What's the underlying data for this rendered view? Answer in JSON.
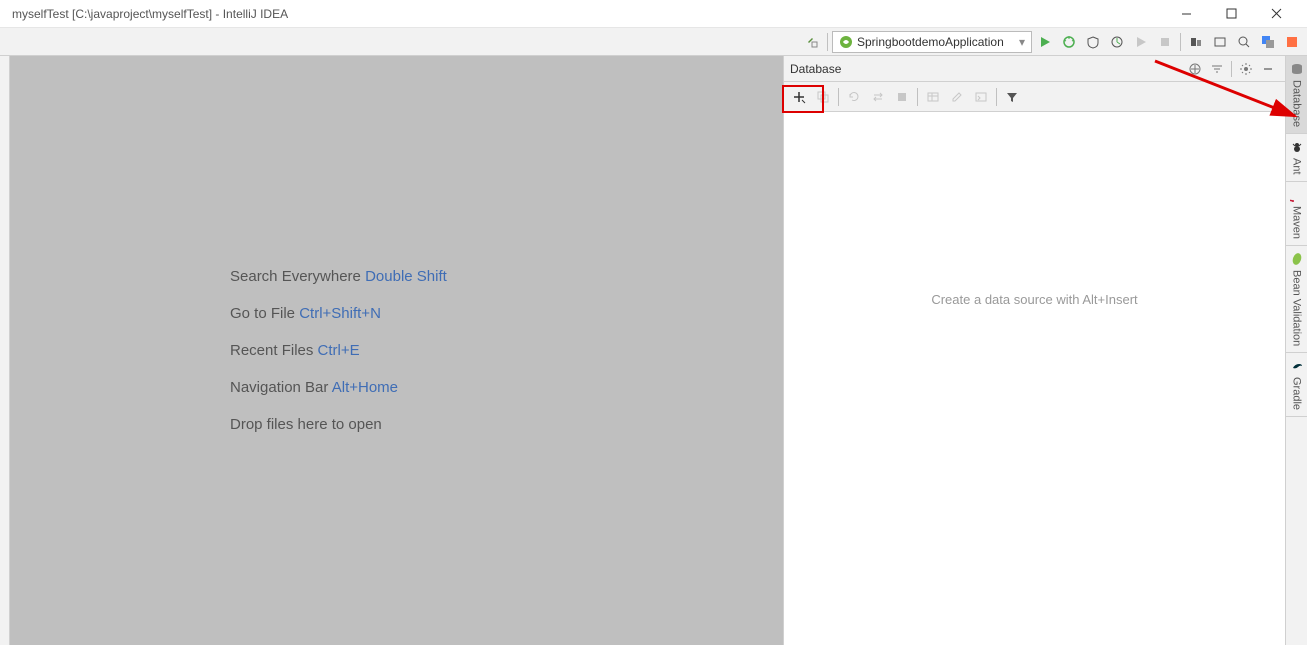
{
  "window": {
    "title": "myselfTest [C:\\javaproject\\myselfTest] - IntelliJ IDEA"
  },
  "toolbar": {
    "run_config": "SpringbootdemoApplication"
  },
  "editor_hints": [
    {
      "label": "Search Everywhere",
      "shortcut": "Double Shift"
    },
    {
      "label": "Go to File",
      "shortcut": "Ctrl+Shift+N"
    },
    {
      "label": "Recent Files",
      "shortcut": "Ctrl+E"
    },
    {
      "label": "Navigation Bar",
      "shortcut": "Alt+Home"
    },
    {
      "label": "Drop files here to open",
      "shortcut": ""
    }
  ],
  "database_panel": {
    "title": "Database",
    "placeholder": "Create a data source with Alt+Insert"
  },
  "right_tabs": [
    {
      "label": "Database",
      "icon": "database"
    },
    {
      "label": "Ant",
      "icon": "ant"
    },
    {
      "label": "Maven",
      "icon": "maven"
    },
    {
      "label": "Bean Validation",
      "icon": "bean"
    },
    {
      "label": "Gradle",
      "icon": "gradle"
    }
  ]
}
